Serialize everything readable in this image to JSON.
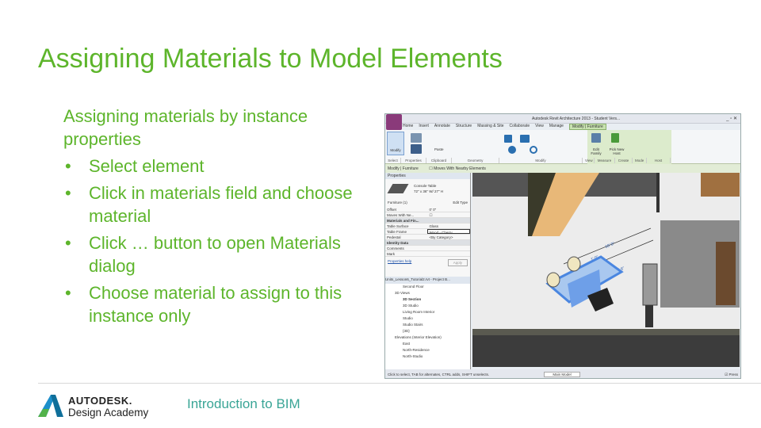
{
  "slide": {
    "title": "Assigning Materials to Model Elements",
    "lead": "Assigning materials by instance properties",
    "bullet_char": "•",
    "bullets": [
      "Select element",
      "Click in materials field and choose material",
      "Click … button to open Materials dialog",
      "Choose material to assign to this instance only"
    ],
    "footer": "Introduction to BIM",
    "brand_line1": "AUTODESK.",
    "brand_line2": "Design Academy",
    "colors": {
      "title": "#5db52b",
      "footer": "#3aa596"
    }
  },
  "revit": {
    "window_title": "Autodesk Revit Architecture 2013 - Student Vers...",
    "tabs": [
      "Home",
      "Insert",
      "Annotate",
      "Structure",
      "Massing & Site",
      "Collaborate",
      "View",
      "Manage",
      "Modify | Furniture"
    ],
    "panels": [
      "Select",
      "Properties",
      "Clipboard",
      "Geometry",
      "Modify",
      "View",
      "Measure",
      "Create",
      "Mode",
      "Host"
    ],
    "ribbon_buttons": {
      "modify": "Modify",
      "paste": "Paste",
      "edit_family": "Edit Family",
      "pick_host": "Pick New Host"
    },
    "options_bar": {
      "context": "Modify | Furniture",
      "checkbox": "Moves With Nearby Elements"
    },
    "properties": {
      "header": "Properties",
      "type_name": "Console Table",
      "type_sub": "72\" x 36\" W/ 27\" H",
      "selector": "Furniture (1)",
      "edit_type": "Edit Type",
      "rows": [
        {
          "label": "Offset",
          "value": "0' 0\""
        },
        {
          "label": "Moves With Ne...",
          "value": ""
        },
        {
          "label": "Materials and Fin...",
          "value": "",
          "group": true
        },
        {
          "label": "Table Surface",
          "value": "Glass"
        },
        {
          "label": "Table Frame",
          "value": "Wood - Cherry"
        },
        {
          "label": "Pedestal",
          "value": "<By Category>"
        },
        {
          "label": "Identity Data",
          "value": "",
          "group": true
        },
        {
          "label": "Comments",
          "value": ""
        },
        {
          "label": "Mark",
          "value": ""
        }
      ],
      "help_link": "Properties help",
      "apply": "Apply"
    },
    "browser": {
      "header": "Units_Lesson6_Tutorial2.rvt - Project B...",
      "items": [
        "Second Floor",
        "3D Views",
        "3D Section",
        "3D Studio",
        "Living Room Interior",
        "Studio",
        "Studio Stairs",
        "{3D}",
        "Elevations (Interior Elevation)",
        "East",
        "North-Residence",
        "North-Studio"
      ]
    },
    "status": "Click to select, TAB for alternates, CTRL adds, SHIFT unselects.",
    "workset": "Main Model",
    "press_drag": "Press",
    "dimension_labels": [
      "1' 0\"",
      "4' 6\"",
      "10' 0\""
    ]
  }
}
